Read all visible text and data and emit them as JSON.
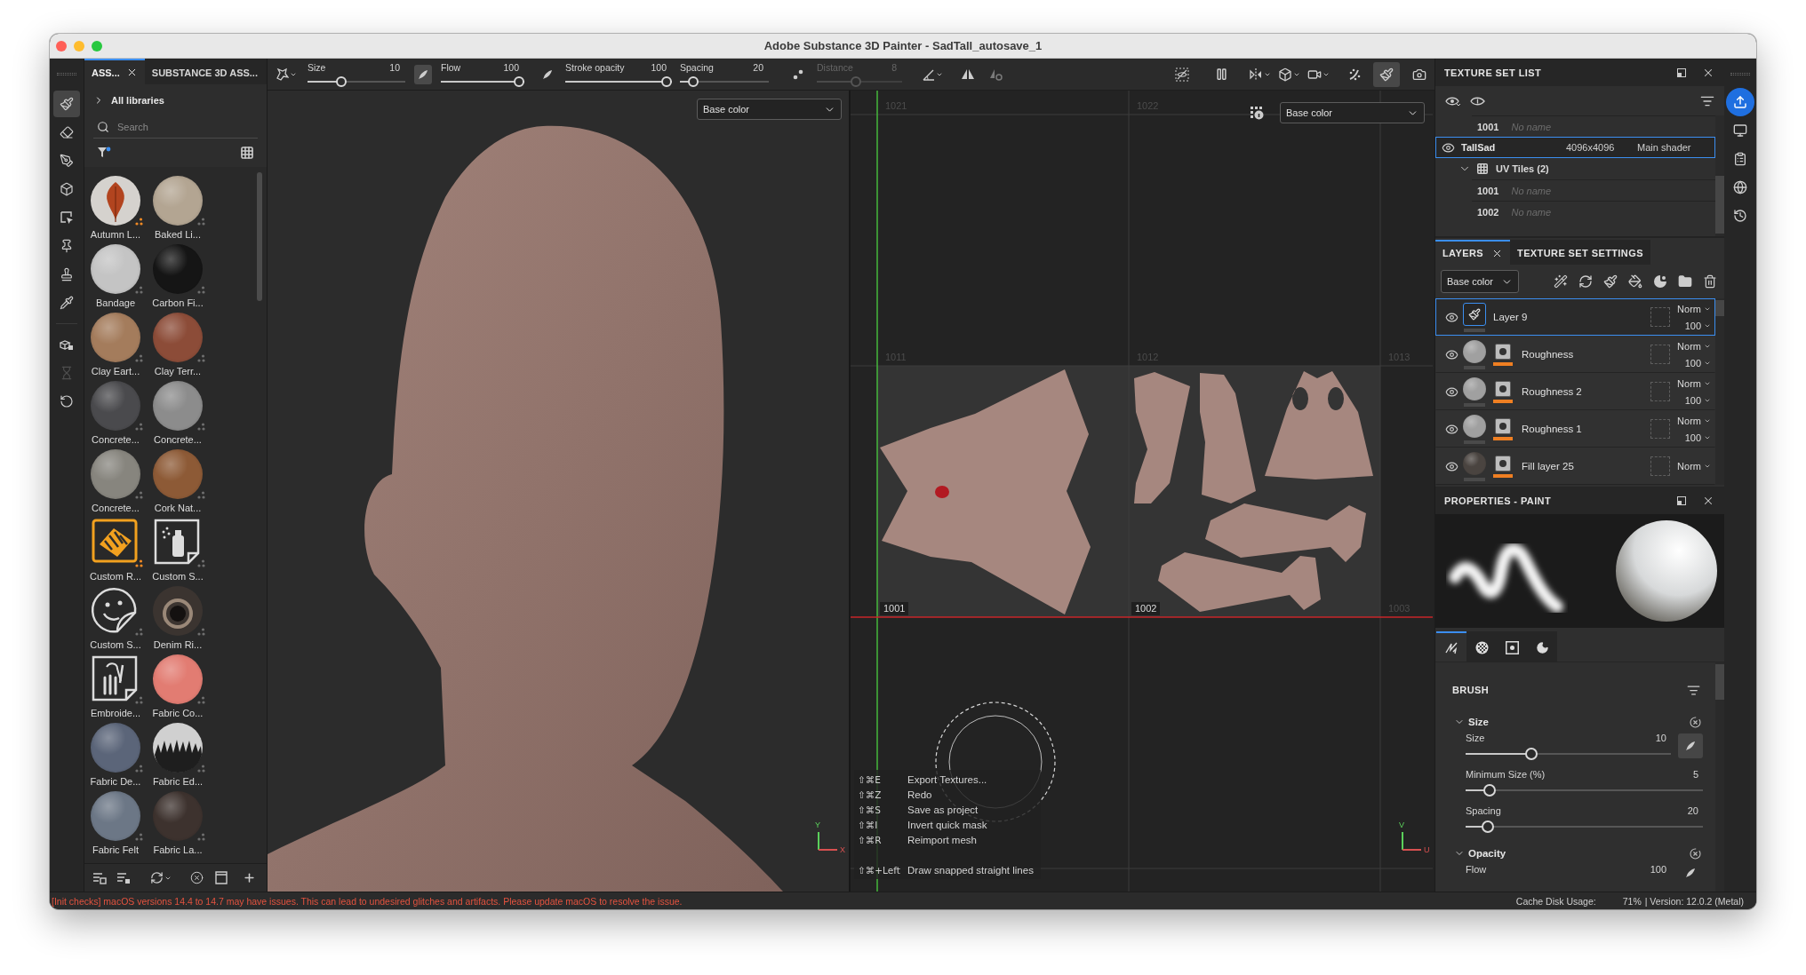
{
  "window": {
    "title": "Adobe Substance 3D Painter - SadTall_autosave_1"
  },
  "tools": [
    {
      "selected": true
    },
    {
      "selected": false
    },
    {
      "selected": false
    },
    {
      "selected": false
    },
    {
      "selected": false
    },
    {
      "selected": false
    },
    {
      "selected": false
    },
    {
      "selected": false
    }
  ],
  "utilities": [
    {
      "disabled": false
    },
    {
      "disabled": true
    },
    {
      "disabled": false
    }
  ],
  "assets": {
    "tabs": [
      {
        "label": "ASS...",
        "selected": true
      },
      {
        "label": "SUBSTANCE 3D ASS...",
        "selected": false
      }
    ],
    "library": "All libraries",
    "search": {
      "placeholder": "Search"
    },
    "items": [
      {
        "label": "Autumn L...",
        "kind": "leaf",
        "color": "#d5d2ce",
        "flagged": true
      },
      {
        "label": "Baked Li...",
        "kind": "sphere",
        "color": "#b3a592",
        "flagged": false
      },
      {
        "label": "Bandage",
        "kind": "sphere",
        "color": "#c4c4c4",
        "flagged": false
      },
      {
        "label": "Carbon Fi...",
        "kind": "sphere",
        "color": "#151515",
        "flagged": false
      },
      {
        "label": "Clay Eart...",
        "kind": "sphere",
        "color": "#a47c5c",
        "flagged": false
      },
      {
        "label": "Clay Terr...",
        "kind": "sphere",
        "color": "#8c4c38",
        "flagged": false
      },
      {
        "label": "Concrete...",
        "kind": "sphere",
        "color": "#4a4a4d",
        "flagged": false
      },
      {
        "label": "Concrete...",
        "kind": "sphere",
        "color": "#8c8c8c",
        "flagged": false
      },
      {
        "label": "Concrete...",
        "kind": "sphere",
        "color": "#87857e",
        "flagged": false
      },
      {
        "label": "Cork Nat...",
        "kind": "sphere",
        "color": "#8d5a36",
        "flagged": false
      },
      {
        "label": "Custom R...",
        "kind": "hatch",
        "flagged": true
      },
      {
        "label": "Custom S...",
        "kind": "spray",
        "flagged": false
      },
      {
        "label": "Custom S...",
        "kind": "sticker",
        "flagged": false
      },
      {
        "label": "Denim Ri...",
        "kind": "ring",
        "color": "#3b3430",
        "flagged": false
      },
      {
        "label": "Embroide...",
        "kind": "embroidery",
        "flagged": false
      },
      {
        "label": "Fabric Co...",
        "kind": "sphere",
        "color": "#e27c72",
        "flagged": false
      },
      {
        "label": "Fabric De...",
        "kind": "sphere",
        "color": "#5b6579",
        "flagged": false
      },
      {
        "label": "Fabric Ed...",
        "kind": "fringe",
        "color": "#d0d0d0",
        "flagged": false
      },
      {
        "label": "Fabric Felt",
        "kind": "sphere",
        "color": "#6c7786",
        "flagged": false
      },
      {
        "label": "Fabric La...",
        "kind": "sphere",
        "color": "#3d322e",
        "flagged": false
      }
    ]
  },
  "toolbar": {
    "sliders": [
      {
        "label": "Size",
        "value": "10",
        "level": 0.33,
        "disabled": false,
        "pressure": true
      },
      {
        "label": "Flow",
        "value": "100",
        "level": 1,
        "disabled": false,
        "pressure": false
      },
      {
        "label": "Stroke opacity",
        "value": "100",
        "level": 1,
        "disabled": false
      },
      {
        "label": "Spacing",
        "value": "20",
        "level": 0.1,
        "disabled": false
      },
      {
        "label": "Distance",
        "value": "8",
        "level": 0.45,
        "disabled": true
      }
    ],
    "view_buttons": [
      {
        "selected": false
      },
      {
        "selected": false
      },
      {
        "selected": false
      },
      {
        "selected": false
      },
      {
        "selected": false
      },
      {
        "selected": false
      },
      {
        "selected": true
      },
      {
        "selected": false
      }
    ]
  },
  "viewport_3d": {
    "channel": "Base color",
    "axes": [
      "Y",
      "X"
    ]
  },
  "uv_view": {
    "channel": "Base color",
    "tile_rows": [
      {
        "tiles": [
          {
            "label": "1021",
            "filled": false
          },
          {
            "label": "1022",
            "filled": false
          }
        ]
      },
      {
        "tiles": [
          {
            "label": "1011",
            "filled": false
          },
          {
            "label": "1012",
            "filled": false
          },
          {
            "label": "1013",
            "filled": false
          }
        ]
      },
      {
        "tiles": [
          {
            "label": "1001",
            "filled": true
          },
          {
            "label": "1002",
            "filled": true
          },
          {
            "label": "1003",
            "filled": false
          }
        ]
      }
    ],
    "shortcuts": [
      {
        "keys": "⇧⌘E",
        "action": "Export Textures..."
      },
      {
        "keys": "⇧⌘Z",
        "action": "Redo"
      },
      {
        "keys": "⇧⌘S",
        "action": "Save as project"
      },
      {
        "keys": "⇧⌘I",
        "action": "Invert quick mask"
      },
      {
        "keys": "⇧⌘R",
        "action": "Reimport mesh"
      },
      {
        "keys": "⇧⌘+Left",
        "action": "Draw snapped straight lines"
      }
    ],
    "axes": [
      "V",
      "U"
    ]
  },
  "texture_set_list": {
    "title": "TEXTURE SET LIST",
    "rows": [
      {
        "kind": "tile",
        "id": "1001",
        "name": "No name",
        "selected": false
      },
      {
        "kind": "set",
        "name": "TallSad",
        "resolution": "4096x4096",
        "shader": "Main shader",
        "selected": true,
        "children": [
          {
            "kind": "group",
            "label": "UV Tiles (2)",
            "expanded": true,
            "selected": false,
            "children": [
              {
                "kind": "tile",
                "id": "1001",
                "name": "No name",
                "selected": false
              },
              {
                "kind": "tile",
                "id": "1002",
                "name": "No name",
                "selected": false
              }
            ]
          }
        ]
      }
    ]
  },
  "layers": {
    "tabs": [
      {
        "label": "LAYERS",
        "selected": true
      },
      {
        "label": "TEXTURE SET SETTINGS",
        "selected": false
      }
    ],
    "channel": "Base color",
    "items": [
      {
        "name": "Layer 9",
        "kind": "paint",
        "selected": true,
        "visible": true,
        "mask": false,
        "blend": "Norm",
        "opacity": "100"
      },
      {
        "name": "Roughness",
        "kind": "fill",
        "color": "#a0a0a0",
        "selected": false,
        "visible": true,
        "mask": true,
        "blend": "Norm",
        "opacity": "100"
      },
      {
        "name": "Roughness 2",
        "kind": "fill",
        "color": "#a0a0a0",
        "selected": false,
        "visible": true,
        "mask": true,
        "blend": "Norm",
        "opacity": "100"
      },
      {
        "name": "Roughness 1",
        "kind": "fill",
        "color": "#a0a0a0",
        "selected": false,
        "visible": true,
        "mask": true,
        "blend": "Norm",
        "opacity": "100"
      },
      {
        "name": "Fill layer 25",
        "kind": "fill",
        "color": "#4a4440",
        "selected": false,
        "visible": true,
        "mask": true,
        "blend": "Norm"
      }
    ]
  },
  "properties": {
    "title": "PROPERTIES - PAINT",
    "tabs": [
      {
        "selected": true
      },
      {
        "selected": false
      },
      {
        "selected": false
      },
      {
        "selected": false
      }
    ],
    "section": "BRUSH",
    "groups": [
      {
        "title": "Size",
        "expanded": true,
        "params": [
          {
            "label": "Size",
            "value": "10",
            "level": 0.31,
            "pressure": true
          },
          {
            "label": "Minimum Size (%)",
            "value": "5",
            "level": 0.08
          },
          {
            "label": "Spacing",
            "value": "20",
            "level": 0.07
          }
        ]
      },
      {
        "title": "Opacity",
        "expanded": true,
        "params": [
          {
            "label": "Flow",
            "value": "100",
            "pressure": false
          }
        ]
      }
    ]
  },
  "status_bar": {
    "message": "[Init checks] macOS versions 14.4 to 14.7 may have issues. This can lead to undesired glitches and artifacts. Please update macOS to resolve the issue.",
    "cache_label": "Cache Disk Usage:",
    "cache_value": "71%",
    "version": "| Version: 12.0.2 (Metal)"
  }
}
